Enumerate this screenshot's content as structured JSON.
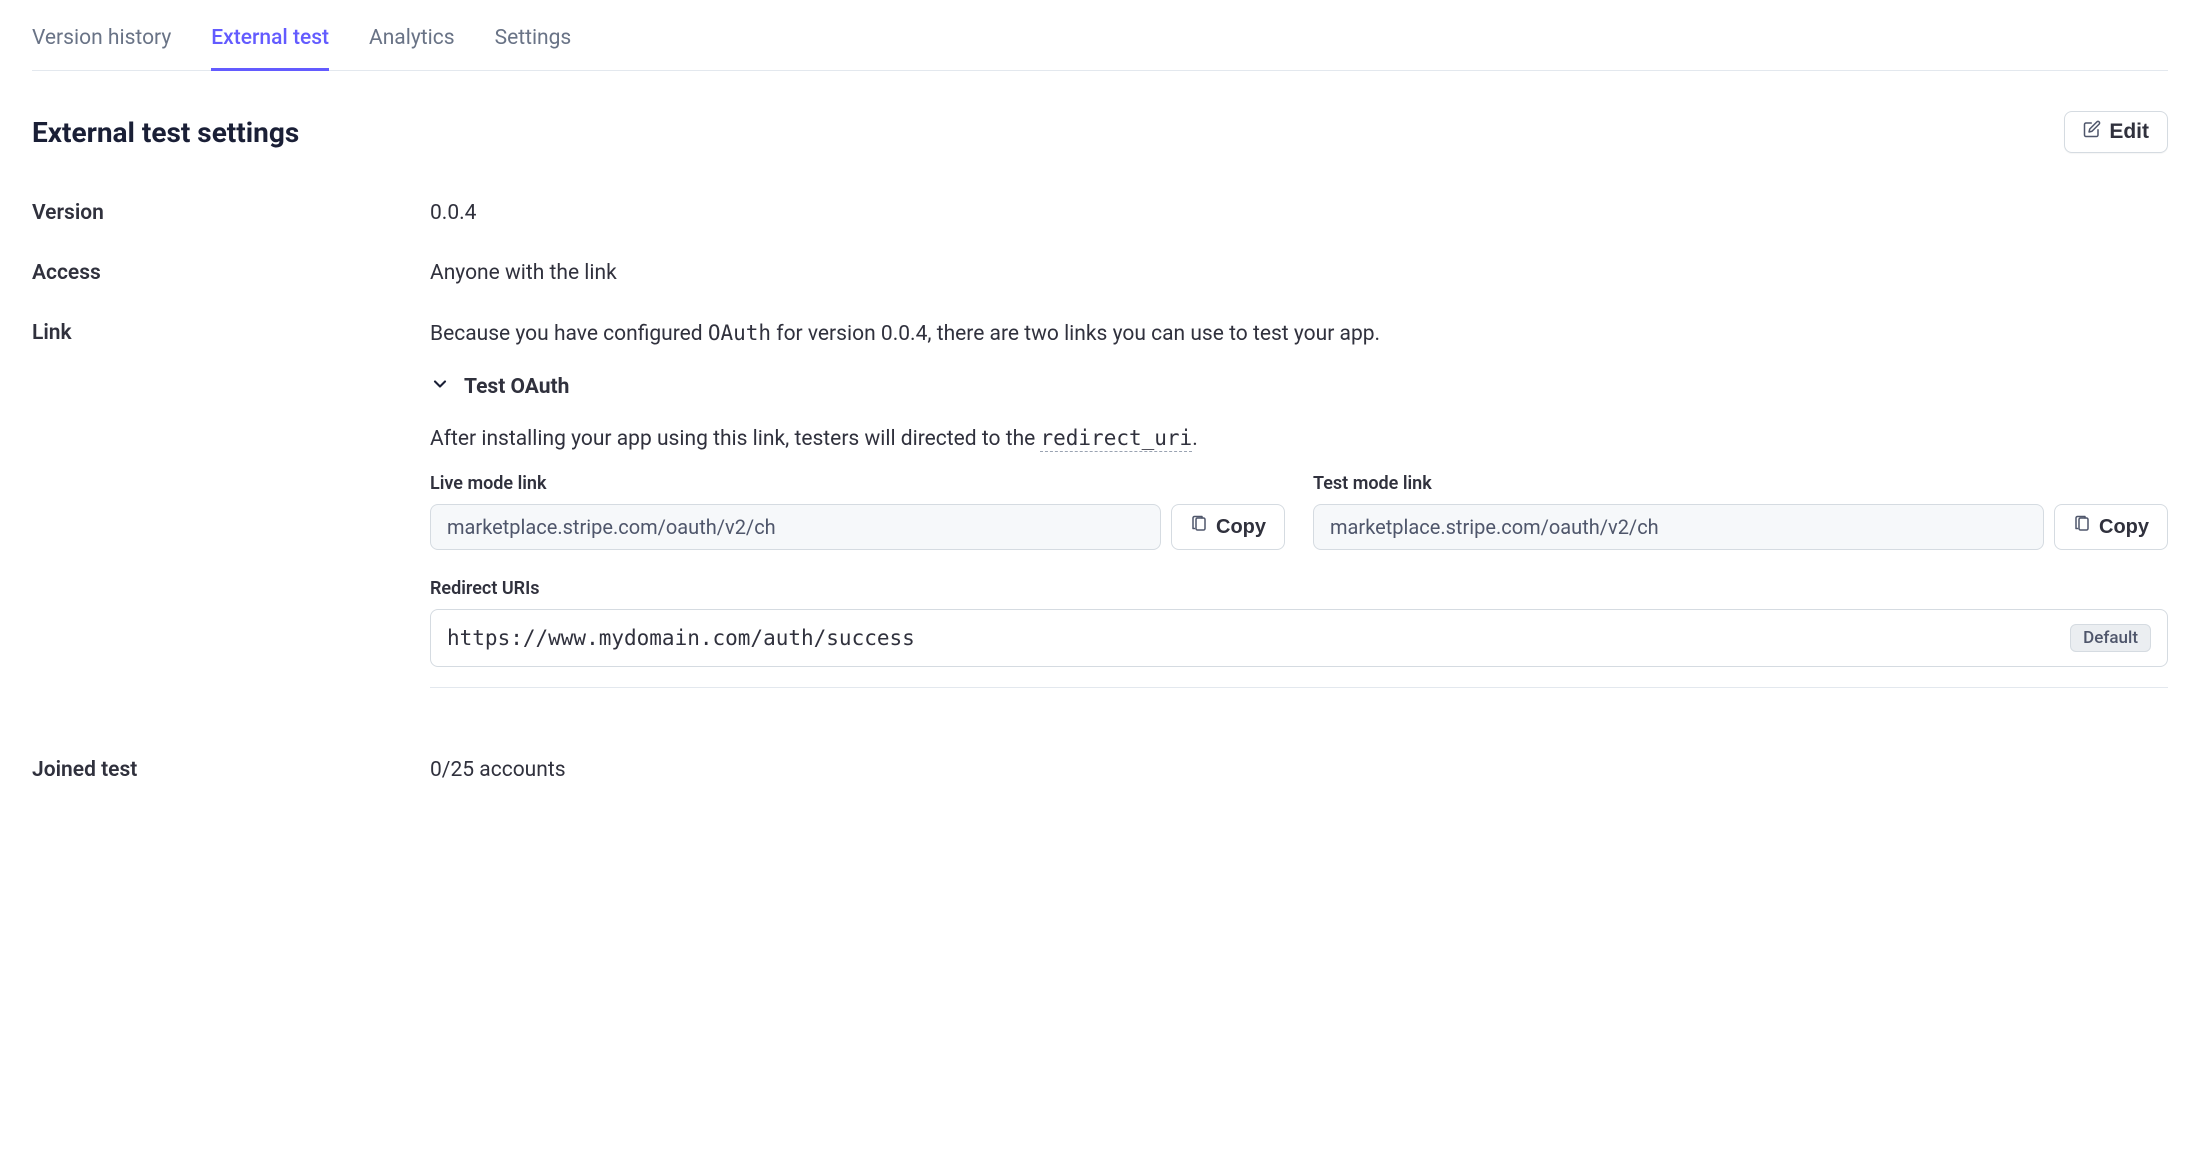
{
  "tabs": [
    {
      "label": "Version history",
      "active": false
    },
    {
      "label": "External test",
      "active": true
    },
    {
      "label": "Analytics",
      "active": false
    },
    {
      "label": "Settings",
      "active": false
    }
  ],
  "header": {
    "title": "External test settings",
    "edit_label": "Edit"
  },
  "rows": {
    "version": {
      "label": "Version",
      "value": "0.0.4"
    },
    "access": {
      "label": "Access",
      "value": "Anyone with the link"
    },
    "link": {
      "label": "Link",
      "description_pre": "Because you have configured ",
      "oauth_token": "OAuth",
      "description_post": " for version 0.0.4, there are two links you can use to test your app."
    },
    "joined": {
      "label": "Joined test",
      "value": "0/25 accounts"
    }
  },
  "oauth": {
    "collapse_title": "Test OAuth",
    "instruction_pre": "After installing your app using this link, testers will directed to the ",
    "redirect_uri_token": "redirect_uri",
    "instruction_post": ".",
    "live": {
      "label": "Live mode link",
      "url": "marketplace.stripe.com/oauth/v2/ch",
      "copy_label": "Copy"
    },
    "test": {
      "label": "Test mode link",
      "url": "marketplace.stripe.com/oauth/v2/ch",
      "copy_label": "Copy"
    },
    "redirect_section_label": "Redirect URIs",
    "redirect_uri": "https://www.mydomain.com/auth/success",
    "default_badge": "Default"
  }
}
